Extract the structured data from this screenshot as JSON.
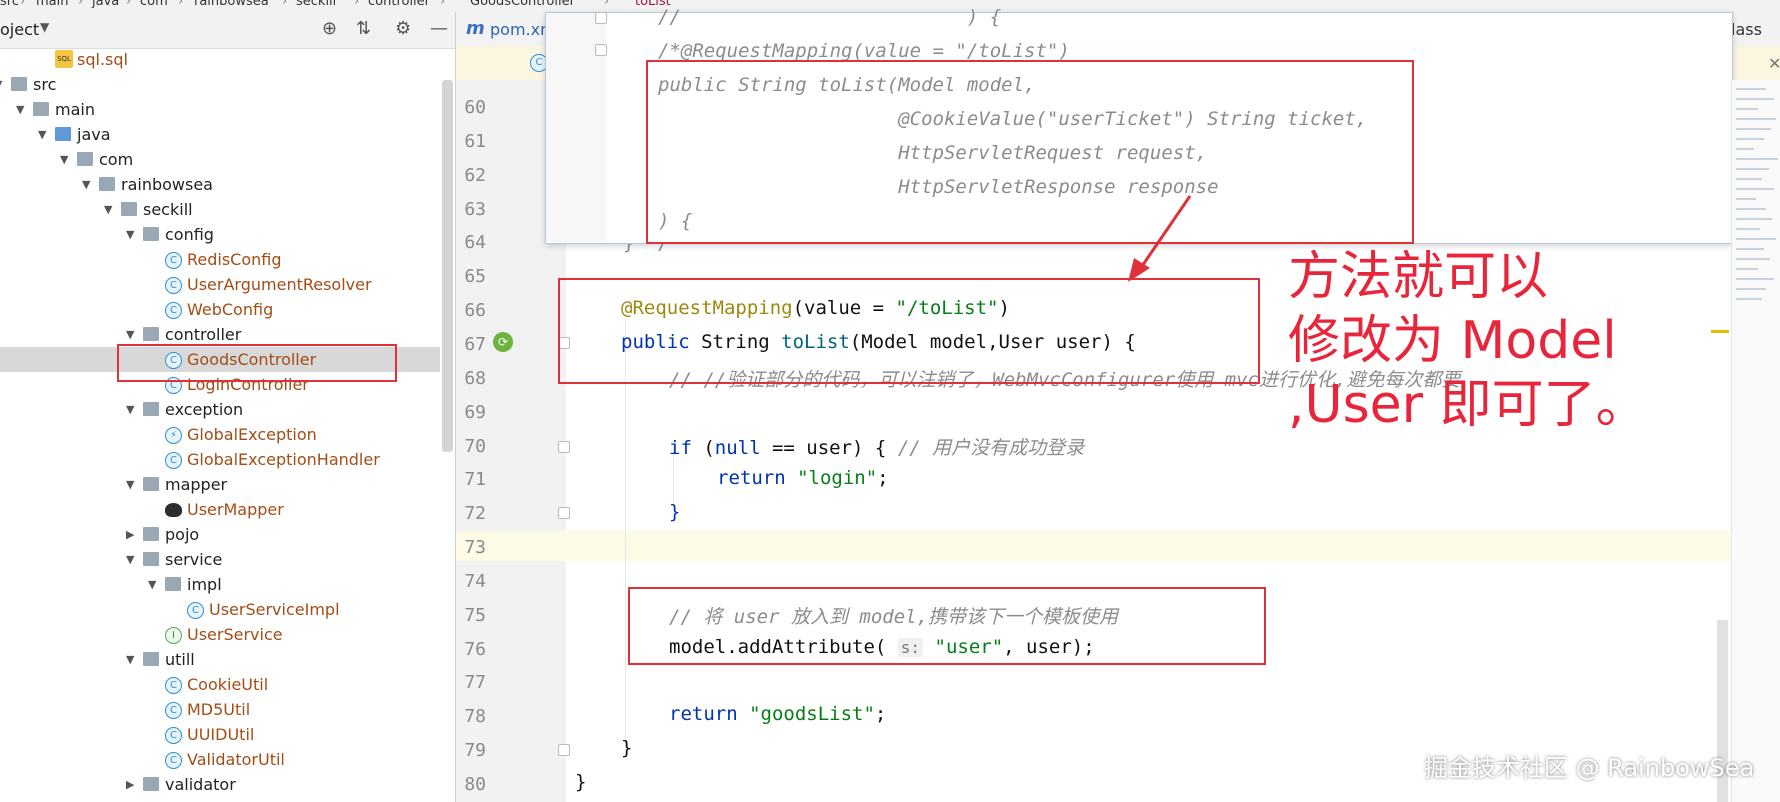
{
  "breadcrumb": [
    "src",
    "main",
    "java",
    "com",
    "rainbowsea",
    "seckill",
    "controller",
    "GoodsController",
    "toList"
  ],
  "project_panel": {
    "title": "oject",
    "tree": [
      {
        "label": "sql.sql",
        "type": "sql",
        "depth": 2
      },
      {
        "label": "src",
        "type": "folder",
        "depth": 0,
        "expanded": true
      },
      {
        "label": "main",
        "type": "folder",
        "depth": 1,
        "expanded": true
      },
      {
        "label": "java",
        "type": "folder-blue",
        "depth": 2,
        "expanded": true
      },
      {
        "label": "com",
        "type": "folder",
        "depth": 3,
        "expanded": true
      },
      {
        "label": "rainbowsea",
        "type": "folder",
        "depth": 4,
        "expanded": true
      },
      {
        "label": "seckill",
        "type": "folder",
        "depth": 5,
        "expanded": true
      },
      {
        "label": "config",
        "type": "folder",
        "depth": 6,
        "expanded": true
      },
      {
        "label": "RedisConfig",
        "type": "class",
        "depth": 7
      },
      {
        "label": "UserArgumentResolver",
        "type": "class",
        "depth": 7
      },
      {
        "label": "WebConfig",
        "type": "class",
        "depth": 7
      },
      {
        "label": "controller",
        "type": "folder",
        "depth": 6,
        "expanded": true
      },
      {
        "label": "GoodsController",
        "type": "class",
        "depth": 7,
        "selected": true
      },
      {
        "label": "LoginController",
        "type": "class",
        "depth": 7
      },
      {
        "label": "exception",
        "type": "folder",
        "depth": 6,
        "expanded": true
      },
      {
        "label": "GlobalException",
        "type": "exception",
        "depth": 7
      },
      {
        "label": "GlobalExceptionHandler",
        "type": "class",
        "depth": 7
      },
      {
        "label": "mapper",
        "type": "folder",
        "depth": 6,
        "expanded": true
      },
      {
        "label": "UserMapper",
        "type": "mapper",
        "depth": 7
      },
      {
        "label": "pojo",
        "type": "folder",
        "depth": 6,
        "expanded": false
      },
      {
        "label": "service",
        "type": "folder",
        "depth": 6,
        "expanded": true
      },
      {
        "label": "impl",
        "type": "folder",
        "depth": 7,
        "expanded": true
      },
      {
        "label": "UserServiceImpl",
        "type": "class",
        "depth": 8
      },
      {
        "label": "UserService",
        "type": "interface",
        "depth": 7
      },
      {
        "label": "utill",
        "type": "folder",
        "depth": 6,
        "expanded": true
      },
      {
        "label": "CookieUtil",
        "type": "class",
        "depth": 7
      },
      {
        "label": "MD5Util",
        "type": "class",
        "depth": 7
      },
      {
        "label": "UUIDUtil",
        "type": "class",
        "depth": 7
      },
      {
        "label": "ValidatorUtil",
        "type": "class",
        "depth": 7
      },
      {
        "label": "validator",
        "type": "folder",
        "depth": 6,
        "expanded": false
      }
    ]
  },
  "editor": {
    "tab_pom": "pom.xml",
    "tab_class_fragment": "lass",
    "popup_lines": [
      "//                         ) {",
      "/*@RequestMapping(value = \"/toList\")",
      "public String toList(Model model,",
      "                     @CookieValue(\"userTicket\") String ticket,",
      "                     HttpServletRequest request,",
      "                     HttpServletResponse response",
      ") {"
    ],
    "line_numbers": [
      "60",
      "61",
      "62",
      "63",
      "64",
      "65",
      "66",
      "67",
      "68",
      "69",
      "70",
      "71",
      "72",
      "73",
      "74",
      "75",
      "76",
      "77",
      "78",
      "79",
      "80"
    ],
    "line64_fragment": "} */",
    "code": {
      "l66_ann": "@RequestMapping",
      "l66_rest_a": "(value = ",
      "l66_str": "\"/toList\"",
      "l66_rest_b": ")",
      "l67_kw": "public",
      "l67_type": " String ",
      "l67_fn": "toList",
      "l67_rest": "(Model model,User user) {",
      "l68_comment": "// //验证部分的代码，可以注销了，WebMvcConfigurer使用 mvc进行优化,避免每次都要",
      "l70_kw": "if",
      "l70_a": " (",
      "l70_null": "null",
      "l70_b": " == user) { ",
      "l70_comment": "// 用户没有成功登录",
      "l71_kw": "return",
      "l71_str": " \"login\"",
      "l71_end": ";",
      "l72": "}",
      "l75_comment": "// 将 user 放入到 model,携带该下一个模板使用",
      "l76_a": "model.addAttribute(",
      "l76_hint": "s:",
      "l76_str": " \"user\"",
      "l76_b": ", user);",
      "l78_kw": "return",
      "l78_str": " \"goodsList\"",
      "l78_end": ";",
      "l79": "}",
      "l80": "}"
    }
  },
  "annotation": {
    "text": "方法就可以\n修改为 Model\n,User 即可了。",
    "color": "#e8253a"
  },
  "watermark": "掘金技术社区 @ RainbowSea"
}
